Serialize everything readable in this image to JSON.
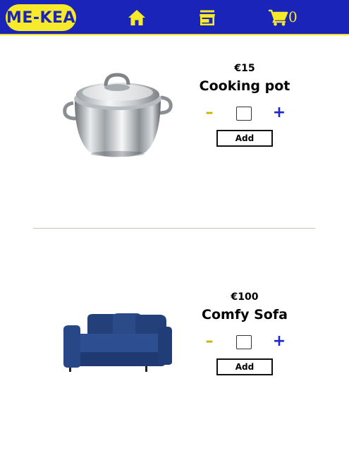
{
  "header": {
    "logo": "ME-KEA",
    "cart_count": "0",
    "icons": [
      "home-icon",
      "store-icon",
      "cart-icon"
    ],
    "colors": {
      "bar": "#1a24b8",
      "accent": "#f6ea2a"
    }
  },
  "products": [
    {
      "price": "€15",
      "name": "Cooking pot",
      "quantity": "",
      "add_label": "Add",
      "image": "cooking-pot-image"
    },
    {
      "price": "€100",
      "name": "Comfy Sofa",
      "quantity": "",
      "add_label": "Add",
      "image": "sofa-image"
    }
  ],
  "controls": {
    "minus": "–",
    "plus": "+"
  }
}
